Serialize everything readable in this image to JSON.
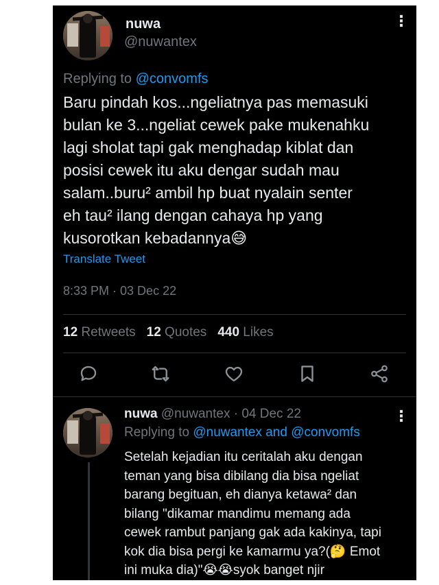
{
  "main_tweet": {
    "display_name": "nuwa",
    "handle": "@nuwantex",
    "replying_prefix": "Replying to ",
    "replying_to": "@convomfs",
    "text": "Baru pindah kos...ngeliatnya pas memasuki\nbulan ke 3...ngeliat cewek pake mukenahku\nlagi sholat tapi gak menghadap kiblat dan\nposisi cewek itu aku dengar sudah mau\nsalam..buru² ambil hp buat nyalain senter\neh tau² ilang dengan cahaya hp yang\nkusorotkan kebadannya😅",
    "translate_label": "Translate Tweet",
    "timestamp": "8:33 PM · 03 Dec 22",
    "retweets_count": "12",
    "retweets_label": "Retweets",
    "quotes_count": "12",
    "quotes_label": "Quotes",
    "likes_count": "440",
    "likes_label": "Likes",
    "actions": [
      "reply-icon",
      "retweet-icon",
      "like-icon",
      "bookmark-icon",
      "share-icon"
    ]
  },
  "reply_tweet": {
    "display_name": "nuwa",
    "handle_date": " @nuwantex · 04 Dec 22",
    "replying_prefix": "Replying to ",
    "replying_to": "@nuwantex and @convomfs",
    "text": "Setelah kejadian itu ceritalah aku dengan\nteman yang bisa dibilang dia bisa ngeliat\nbarang begituan, eh dianya ketawa² dan\nbilang \"dikamar mandimu memang ada\ncewek rambut panjang gak ada kakinya, tapi\nkok dia bisa pergi ke kamarmu ya?(🤔 Emot\nini muka dia)\"😭😭syok banget njir"
  },
  "colors": {
    "background": "#000000",
    "text": "#e7e9ea",
    "muted": "#71767b",
    "accent": "#1d9bf0",
    "divider": "#2f3336"
  }
}
